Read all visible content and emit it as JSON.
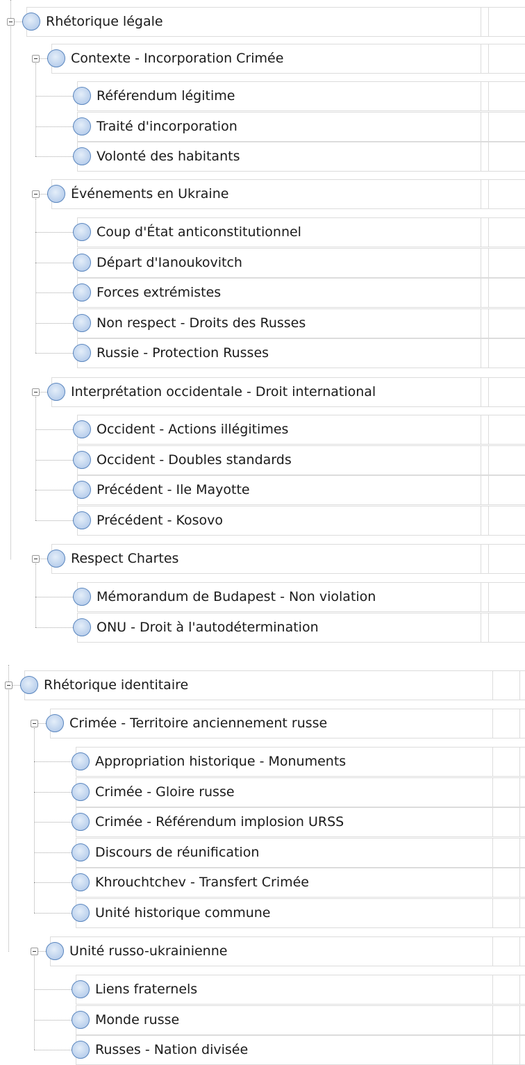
{
  "panels": [
    {
      "label": "Rhétorique légale",
      "children": [
        {
          "label": "Contexte - Incorporation Crimée",
          "children": [
            {
              "label": "Référendum légitime"
            },
            {
              "label": "Traité d'incorporation"
            },
            {
              "label": "Volonté des habitants"
            }
          ]
        },
        {
          "label": "Événements en Ukraine",
          "children": [
            {
              "label": "Coup d'État anticonstitutionnel"
            },
            {
              "label": "Départ d'Ianoukovitch"
            },
            {
              "label": "Forces extrémistes"
            },
            {
              "label": "Non respect - Droits des Russes"
            },
            {
              "label": "Russie - Protection Russes"
            }
          ]
        },
        {
          "label": "Interprétation occidentale - Droit international",
          "children": [
            {
              "label": "Occident - Actions illégitimes"
            },
            {
              "label": "Occident - Doubles standards"
            },
            {
              "label": "Précédent - Ile Mayotte"
            },
            {
              "label": "Précédent - Kosovo"
            }
          ]
        },
        {
          "label": "Respect Chartes",
          "children": [
            {
              "label": "Mémorandum de Budapest - Non violation"
            },
            {
              "label": "ONU - Droit à l'autodétermination"
            }
          ]
        }
      ]
    },
    {
      "label": "Rhétorique identitaire",
      "children": [
        {
          "label": "Crimée - Territoire anciennement russe",
          "children": [
            {
              "label": "Appropriation historique - Monuments"
            },
            {
              "label": "Crimée - Gloire russe"
            },
            {
              "label": "Crimée - Référendum implosion URSS"
            },
            {
              "label": "Discours de réunification"
            },
            {
              "label": "Khrouchtchev - Transfert Crimée"
            },
            {
              "label": "Unité historique commune"
            }
          ]
        },
        {
          "label": "Unité russo-ukrainienne",
          "children": [
            {
              "label": "Liens fraternels"
            },
            {
              "label": "Monde russe"
            },
            {
              "label": "Russes - Nation divisée"
            }
          ]
        }
      ]
    }
  ],
  "icons": {
    "node": "node-circle-icon",
    "collapse": "collapse-toggle-icon"
  },
  "colors": {
    "node_fill": "#c3d6ef",
    "node_border": "#5b87bf",
    "grid": "#dcdcdc",
    "tree_line": "#a9a9a9"
  }
}
